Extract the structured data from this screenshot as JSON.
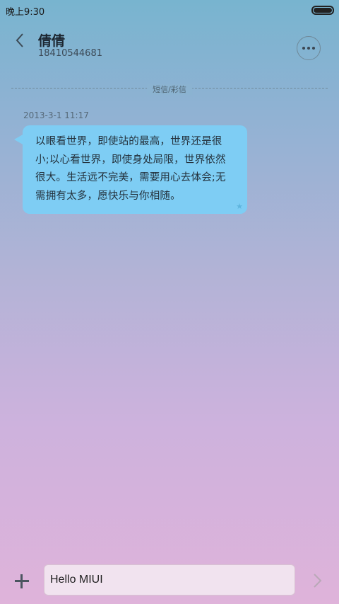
{
  "statusbar": {
    "time": "晚上9:30",
    "battery_icon": "battery-icon"
  },
  "header": {
    "contact_name": "倩倩",
    "contact_number": "18410544681",
    "back_icon": "chevron-left-icon",
    "more_icon": "more-horizontal-icon"
  },
  "conversation": {
    "divider_label": "短信/彩信",
    "messages": [
      {
        "timestamp": "2013-3-1 11:17",
        "text": "以眼看世界，即使站的最高，世界还是很小;以心看世界，即使身处局限，世界依然很大。生活远不完美，需要用心去体会;无需拥有太多，愿快乐与你相随。",
        "starred": true
      }
    ]
  },
  "compose": {
    "input_value": "Hello MIUI",
    "add_icon": "plus-icon",
    "send_icon": "chevron-right-icon"
  },
  "colors": {
    "bubble": "#7ecdf4",
    "bg_top": "#78b4cf",
    "bg_bottom": "#dfb3da"
  }
}
